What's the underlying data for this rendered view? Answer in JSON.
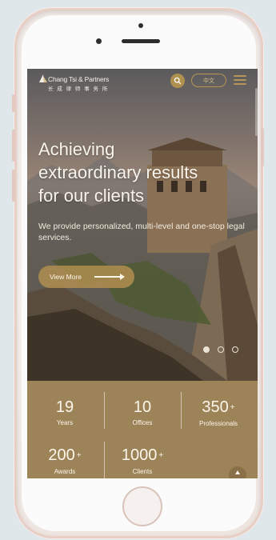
{
  "header": {
    "logo_en": "Chang Tsi & Partners",
    "logo_cn": "长 成 律 师 事 务 所",
    "search_icon": "search-icon",
    "lang_label": "中文",
    "menu_icon": "hamburger-menu-icon"
  },
  "hero": {
    "headline_line1": "Achieving",
    "headline_line2": "extraordinary results",
    "headline_line3": "for our clients",
    "subtext": "We provide personalized, multi-level and one-stop legal services.",
    "cta_label": "View More",
    "carousel_dots": 3,
    "active_dot": 1
  },
  "stats": [
    {
      "value": "19",
      "label": "Years",
      "plus": ""
    },
    {
      "value": "10",
      "label": "Offices",
      "plus": ""
    },
    {
      "value": "350",
      "label": "Professionals",
      "plus": "+"
    },
    {
      "value": "200",
      "label": "Awards",
      "plus": "+"
    },
    {
      "value": "1000",
      "label": "Clients",
      "plus": "+"
    }
  ],
  "colors": {
    "accent_gold": "#b0904f",
    "stats_bg": "#9d8358"
  }
}
